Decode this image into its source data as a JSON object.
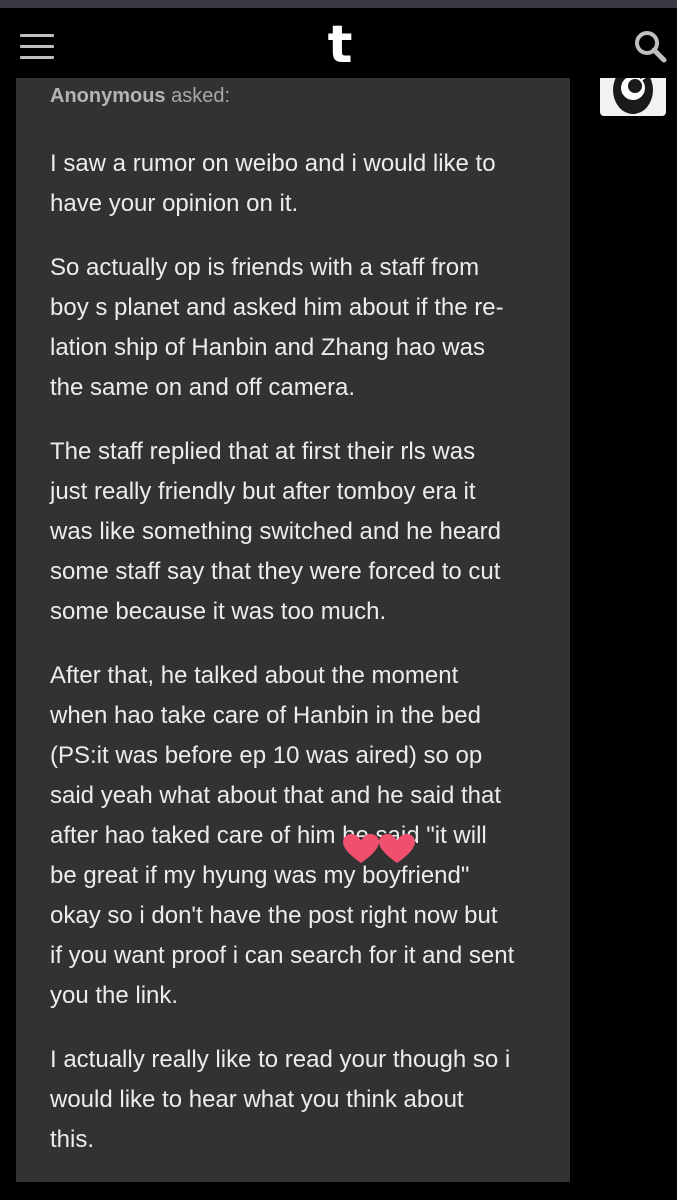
{
  "header": {
    "logo": "t",
    "menu_icon": "hamburger-menu-icon",
    "search_icon": "search-icon",
    "background": "#000000"
  },
  "post": {
    "asker_name": "Anonymous",
    "asker_suffix": " asked:",
    "card_color": "#323232",
    "text_color": "#ececec",
    "lines": [
      "I saw a rumor on weibo and i would like to",
      "have your opinion on it.",
      "So actually op is friends with a staff from",
      "boy s planet and asked him about if the re-",
      "lation ship of Hanbin and Zhang hao was",
      "the same on and off camera.",
      "The staff replied that at first their rls was",
      "just really friendly but after tomboy era it",
      "was like something switched and he heard",
      "some staff say that they were forced to cut",
      "some because it was too much.",
      "After that, he talked about the moment",
      "when hao take care of Hanbin in the bed",
      "(PS:it was before ep 10 was aired) so op",
      "said yeah what about that and he said that",
      "after hao taked care of him he said \"it will",
      "be great if my hyung was my boyfriend\"",
      "okay so i don't have the post right now but",
      "if you want proof i can search for it and sent",
      "you the link.",
      "I actually really like to read your though so i",
      "would like to hear what you think about",
      "this."
    ]
  },
  "overlay": {
    "sticker": "pink-hearts-sticker",
    "heart_color": "#f0506e"
  }
}
